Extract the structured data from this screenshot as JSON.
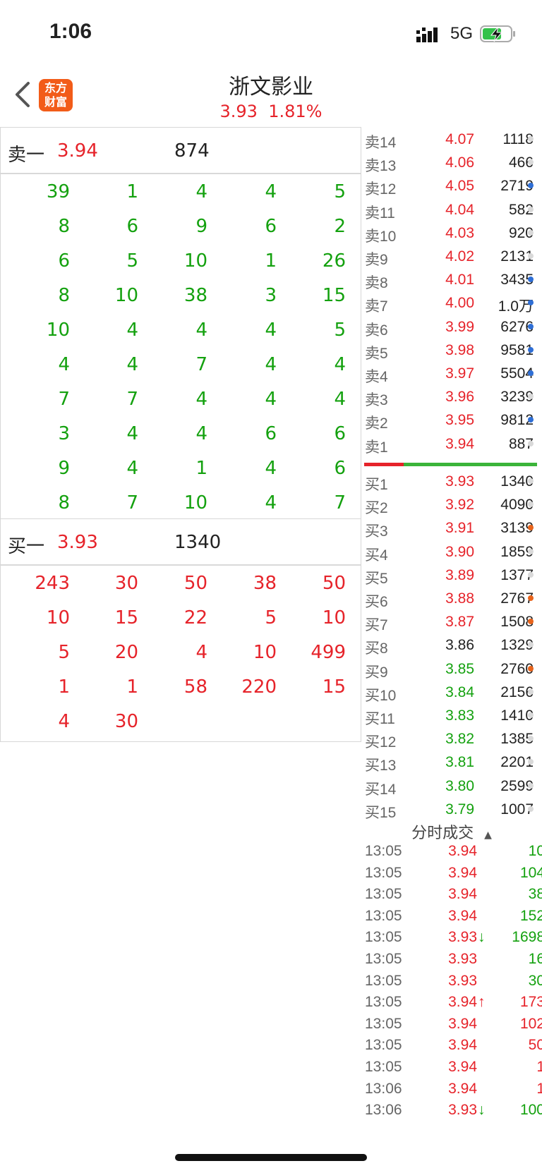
{
  "status_bar": {
    "time": "1:06",
    "network": "5G"
  },
  "header": {
    "logo_line1": "东方",
    "logo_line2": "财富",
    "title": "浙文影业",
    "price": "3.93",
    "change_pct": "1.81%"
  },
  "sell_panel": {
    "label": "卖一",
    "price": "3.94",
    "volume": "874",
    "orders": [
      [
        "39",
        "1",
        "4",
        "4",
        "5"
      ],
      [
        "8",
        "6",
        "9",
        "6",
        "2"
      ],
      [
        "6",
        "5",
        "10",
        "1",
        "26"
      ],
      [
        "8",
        "10",
        "38",
        "3",
        "15"
      ],
      [
        "10",
        "4",
        "4",
        "4",
        "5"
      ],
      [
        "4",
        "4",
        "7",
        "4",
        "4"
      ],
      [
        "7",
        "7",
        "4",
        "4",
        "4"
      ],
      [
        "3",
        "4",
        "4",
        "6",
        "6"
      ],
      [
        "9",
        "4",
        "1",
        "4",
        "6"
      ],
      [
        "8",
        "7",
        "10",
        "4",
        "7"
      ]
    ]
  },
  "buy_panel": {
    "label": "买一",
    "price": "3.93",
    "volume": "1340",
    "orders": [
      [
        "243",
        "30",
        "50",
        "38",
        "50"
      ],
      [
        "10",
        "15",
        "22",
        "5",
        "10"
      ],
      [
        "5",
        "20",
        "4",
        "10",
        "499"
      ],
      [
        "1",
        "1",
        "58",
        "220",
        "15"
      ],
      [
        "4",
        "30"
      ]
    ]
  },
  "depth": {
    "asks": [
      {
        "label": "卖14",
        "price": "4.07",
        "vol": "1118",
        "dot": "#d9d9d9"
      },
      {
        "label": "卖13",
        "price": "4.06",
        "vol": "466",
        "dot": "#d9d9d9"
      },
      {
        "label": "卖12",
        "price": "4.05",
        "vol": "2719",
        "dot": "#2f6fd6"
      },
      {
        "label": "卖11",
        "price": "4.04",
        "vol": "582",
        "dot": "#d9d9d9"
      },
      {
        "label": "卖10",
        "price": "4.03",
        "vol": "920",
        "dot": "#d9d9d9"
      },
      {
        "label": "卖9",
        "price": "4.02",
        "vol": "2131",
        "dot": "#d9d9d9"
      },
      {
        "label": "卖8",
        "price": "4.01",
        "vol": "3435",
        "dot": "#2f6fd6"
      },
      {
        "label": "卖7",
        "price": "4.00",
        "vol": "1.0万",
        "dot": "#2f6fd6"
      },
      {
        "label": "卖6",
        "price": "3.99",
        "vol": "6276",
        "dot": "#2f6fd6"
      },
      {
        "label": "卖5",
        "price": "3.98",
        "vol": "9581",
        "dot": "#2f6fd6"
      },
      {
        "label": "卖4",
        "price": "3.97",
        "vol": "5504",
        "dot": "#2f6fd6"
      },
      {
        "label": "卖3",
        "price": "3.96",
        "vol": "3239",
        "dot": "#d9d9d9"
      },
      {
        "label": "卖2",
        "price": "3.95",
        "vol": "9812",
        "dot": "#2f6fd6"
      },
      {
        "label": "卖1",
        "price": "3.94",
        "vol": "887",
        "dot": "#d9d9d9"
      }
    ],
    "bids": [
      {
        "label": "买1",
        "price": "3.93",
        "vol": "1340",
        "dot": "#d9d9d9",
        "color": "red"
      },
      {
        "label": "买2",
        "price": "3.92",
        "vol": "4090",
        "dot": "#d9d9d9",
        "color": "red"
      },
      {
        "label": "买3",
        "price": "3.91",
        "vol": "3139",
        "dot": "#e8641c",
        "color": "red"
      },
      {
        "label": "买4",
        "price": "3.90",
        "vol": "1859",
        "dot": "#d9d9d9",
        "color": "red"
      },
      {
        "label": "买5",
        "price": "3.89",
        "vol": "1377",
        "dot": "#d9d9d9",
        "color": "red"
      },
      {
        "label": "买6",
        "price": "3.88",
        "vol": "2767",
        "dot": "#e8641c",
        "color": "red"
      },
      {
        "label": "买7",
        "price": "3.87",
        "vol": "1508",
        "dot": "#e8641c",
        "color": "red"
      },
      {
        "label": "买8",
        "price": "3.86",
        "vol": "1329",
        "dot": "#d9d9d9",
        "color": "dark"
      },
      {
        "label": "买9",
        "price": "3.85",
        "vol": "2760",
        "dot": "#e8641c",
        "color": "green"
      },
      {
        "label": "买10",
        "price": "3.84",
        "vol": "2156",
        "dot": "#d9d9d9",
        "color": "green"
      },
      {
        "label": "买11",
        "price": "3.83",
        "vol": "1410",
        "dot": "#d9d9d9",
        "color": "green"
      },
      {
        "label": "买12",
        "price": "3.82",
        "vol": "1385",
        "dot": "#d9d9d9",
        "color": "green"
      },
      {
        "label": "买13",
        "price": "3.81",
        "vol": "2201",
        "dot": "#d9d9d9",
        "color": "green"
      },
      {
        "label": "买14",
        "price": "3.80",
        "vol": "2599",
        "dot": "#d9d9d9",
        "color": "green"
      },
      {
        "label": "买15",
        "price": "3.79",
        "vol": "1007",
        "dot": "#d9d9d9",
        "color": "green"
      }
    ]
  },
  "trades": {
    "header": "分时成交",
    "rows": [
      {
        "time": "13:05",
        "price": "3.94",
        "arrow": "",
        "vol": "10",
        "vol_color": "green"
      },
      {
        "time": "13:05",
        "price": "3.94",
        "arrow": "",
        "vol": "104",
        "vol_color": "green"
      },
      {
        "time": "13:05",
        "price": "3.94",
        "arrow": "",
        "vol": "38",
        "vol_color": "green"
      },
      {
        "time": "13:05",
        "price": "3.94",
        "arrow": "",
        "vol": "152",
        "vol_color": "green"
      },
      {
        "time": "13:05",
        "price": "3.93",
        "arrow": "↓",
        "vol": "1698",
        "vol_color": "green"
      },
      {
        "time": "13:05",
        "price": "3.93",
        "arrow": "",
        "vol": "16",
        "vol_color": "green"
      },
      {
        "time": "13:05",
        "price": "3.93",
        "arrow": "",
        "vol": "30",
        "vol_color": "green"
      },
      {
        "time": "13:05",
        "price": "3.94",
        "arrow": "↑",
        "vol": "173",
        "vol_color": "red"
      },
      {
        "time": "13:05",
        "price": "3.94",
        "arrow": "",
        "vol": "102",
        "vol_color": "red"
      },
      {
        "time": "13:05",
        "price": "3.94",
        "arrow": "",
        "vol": "50",
        "vol_color": "red"
      },
      {
        "time": "13:05",
        "price": "3.94",
        "arrow": "",
        "vol": "1",
        "vol_color": "red"
      },
      {
        "time": "13:06",
        "price": "3.94",
        "arrow": "",
        "vol": "1",
        "vol_color": "red"
      },
      {
        "time": "13:06",
        "price": "3.93",
        "arrow": "↓",
        "vol": "100",
        "vol_color": "green"
      }
    ]
  }
}
